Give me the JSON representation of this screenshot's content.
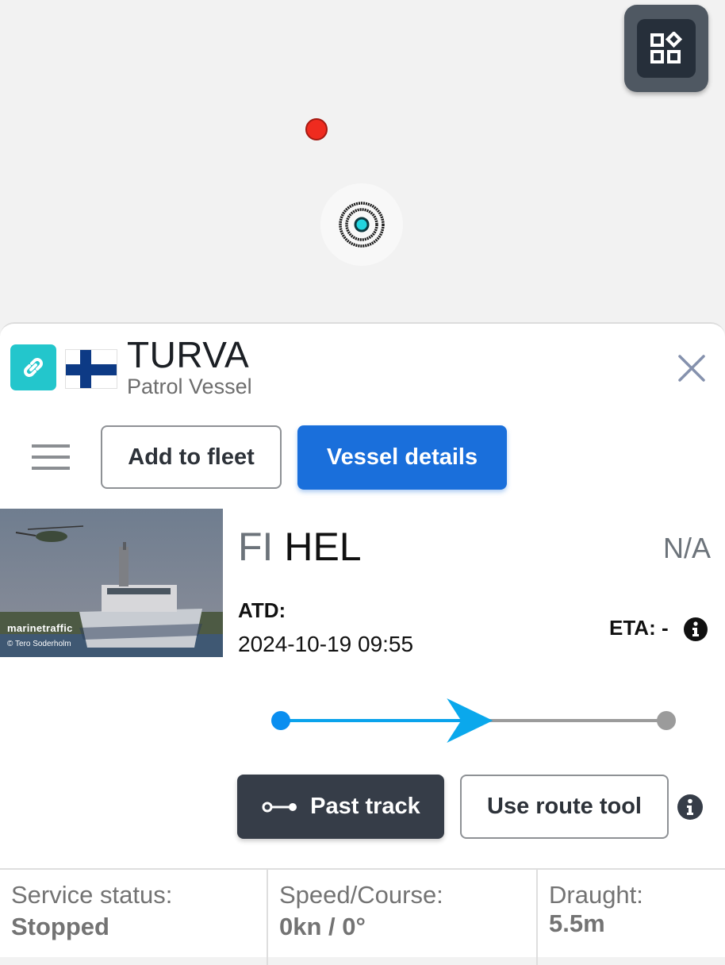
{
  "map": {
    "layers_button_icon": "layers-grid-icon",
    "markers": [
      {
        "type": "vessel-position",
        "color": "#ef2b1f"
      },
      {
        "type": "target-location",
        "color": "#23d5e0"
      }
    ]
  },
  "vessel": {
    "name": "TURVA",
    "type": "Patrol Vessel",
    "flag": "Finland",
    "link_icon": "link-icon",
    "close_icon": "close-icon"
  },
  "actions": {
    "menu_icon": "hamburger-menu-icon",
    "add_to_fleet": "Add to fleet",
    "vessel_details": "Vessel details"
  },
  "photo": {
    "watermark": "marinetraffic",
    "credit": "© Tero Soderholm"
  },
  "voyage": {
    "origin_country": "FI",
    "origin_port": "HEL",
    "destination": "N/A",
    "atd_label": "ATD:",
    "atd_value": "2024-10-19 09:55",
    "eta_label": "ETA: -",
    "progress_fraction": 0.55
  },
  "track": {
    "past_track": "Past track",
    "use_route_tool": "Use route tool"
  },
  "stats": [
    {
      "label": "Service status:",
      "value": "Stopped"
    },
    {
      "label": "Speed/Course:",
      "value": "0kn / 0°"
    },
    {
      "label": "Draught:",
      "value": "5.5m"
    }
  ],
  "colors": {
    "primary": "#1a6fdb",
    "dark_button": "#363d48",
    "route_blue": "#0aa3ec",
    "route_grey": "#9b9b9b",
    "link_badge": "#23c6cc"
  }
}
